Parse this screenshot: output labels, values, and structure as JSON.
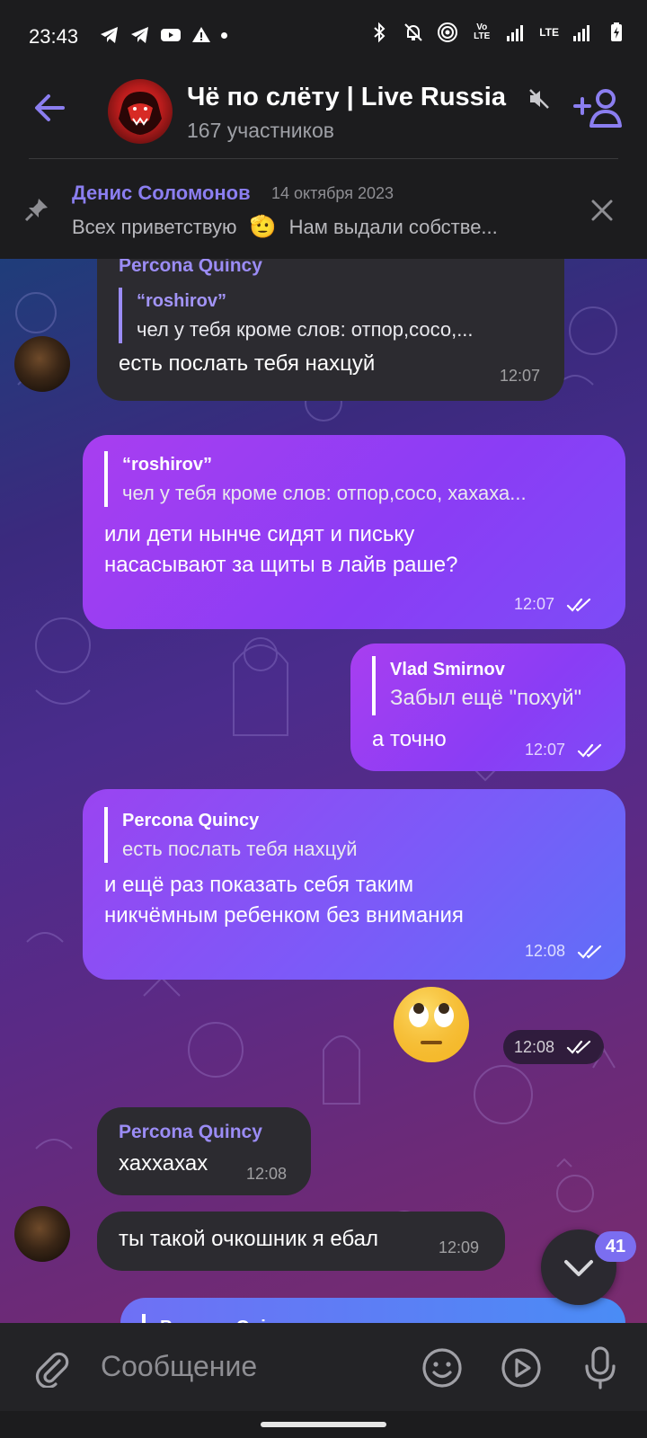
{
  "status_bar": {
    "time": "23:43",
    "left_icons": [
      "telegram-icon",
      "telegram-icon",
      "youtube-icon",
      "warning-icon",
      "dot-icon"
    ],
    "right_icons": [
      "bluetooth-icon",
      "bell-off-icon",
      "hotspot-icon",
      "volte-icon",
      "signal-icon",
      "lte-icon",
      "signal-icon",
      "battery-charging-icon"
    ],
    "volte_text": "Vo LTE",
    "lte_text": "LTE"
  },
  "header": {
    "title": "Чё по слёту | Live Russia",
    "subtitle": "167 участников",
    "muted": true
  },
  "pinned": {
    "author": "Денис Соломонов",
    "date": "14 октября 2023",
    "text_before_emoji": "Всех приветствую",
    "emoji": "🫡",
    "text_after_emoji": "Нам выдали собстве..."
  },
  "messages": [
    {
      "id": "m1",
      "direction": "in",
      "sender": "Percona Quincy",
      "quote_author": "“roshirov”",
      "quote_text": "чел у тебя кроме слов: отпор,сосо,...",
      "text": "есть послать тебя нахцуй",
      "time": "12:07"
    },
    {
      "id": "m2",
      "direction": "out",
      "quote_author": "“roshirov”",
      "quote_text": "чел у тебя кроме слов: отпор,сосо, хахаха...",
      "text_line1": "или дети нынче сидят и письку",
      "text_line2": "насасывают за щиты в лайв раше?",
      "time": "12:07",
      "read": true
    },
    {
      "id": "m3",
      "direction": "out",
      "quote_author": "Vlad Smirnov",
      "quote_text": "Забыл ещё \"похуй\"",
      "text": "а точно",
      "time": "12:07",
      "read": true
    },
    {
      "id": "m4",
      "direction": "out",
      "quote_author": "Percona Quincy",
      "quote_text": "есть послать тебя нахцуй",
      "text_line1": "и ещё раз показать себя таким",
      "text_line2": "никчёмным ребенком без внимания",
      "time": "12:08",
      "read": true
    },
    {
      "id": "m5",
      "direction": "out",
      "emoji": "🙄",
      "time": "12:08",
      "read": true
    },
    {
      "id": "m6",
      "direction": "in",
      "sender": "Percona Quincy",
      "text": "хаххахах",
      "time": "12:08"
    },
    {
      "id": "m7",
      "direction": "in",
      "text": "ты такой очкошник я ебал",
      "time": "12:09"
    },
    {
      "id": "m8",
      "direction": "out",
      "quote_author_partial": "Percona Quincy"
    }
  ],
  "scroll_button": {
    "unread_count": "41"
  },
  "composer": {
    "placeholder": "Сообщение"
  },
  "colors": {
    "accent": "#8b7ef0",
    "incoming_bubble": "#2c2b30",
    "outgoing_gradient_start": "#a83ef0",
    "outgoing_gradient_end": "#7d4cf7",
    "header_bg": "#1c1c1e",
    "composer_bg": "#232326"
  }
}
